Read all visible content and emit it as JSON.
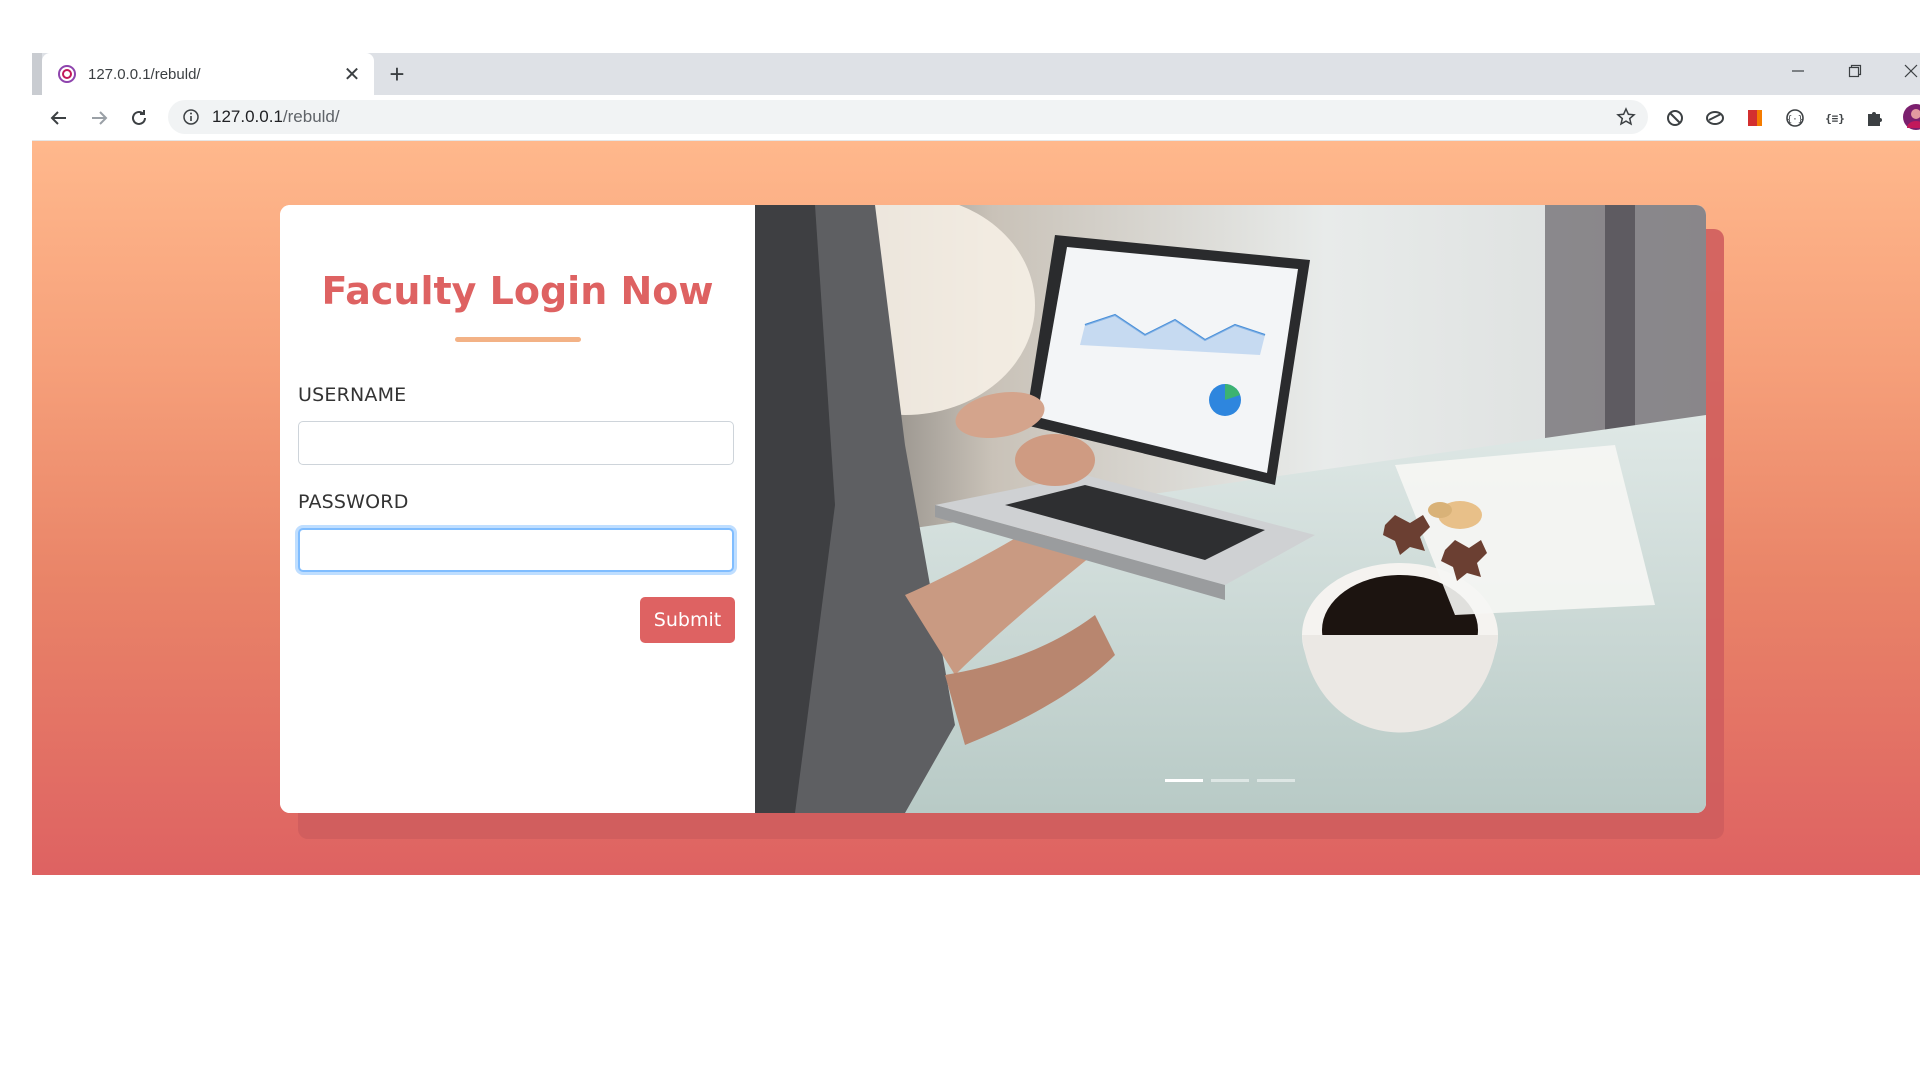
{
  "browser": {
    "tab_title": "127.0.0.1/rebuld/",
    "new_tab_symbol": "+",
    "close_symbol": "✕",
    "url_host": "127.0.0.1",
    "url_path": "/rebuld/",
    "icons": [
      "back-icon",
      "forward-icon",
      "reload-icon",
      "info-icon",
      "star-icon",
      "block-icon",
      "extension-icon",
      "bookmark-icon",
      "code-icon",
      "json-icon",
      "puzzle-icon",
      "avatar"
    ]
  },
  "login": {
    "title": "Faculty Login Now",
    "username_label": "USERNAME",
    "username_value": "",
    "password_label": "PASSWORD",
    "password_value": "",
    "submit_label": "Submit"
  },
  "carousel": {
    "image_description_icon": "laptop-photo",
    "indicators": [
      true,
      false,
      false
    ]
  },
  "colors": {
    "accent": "#de6262",
    "gradient_top": "#ffb88c",
    "gradient_bottom": "#de6262",
    "underline": "#f3b286"
  }
}
